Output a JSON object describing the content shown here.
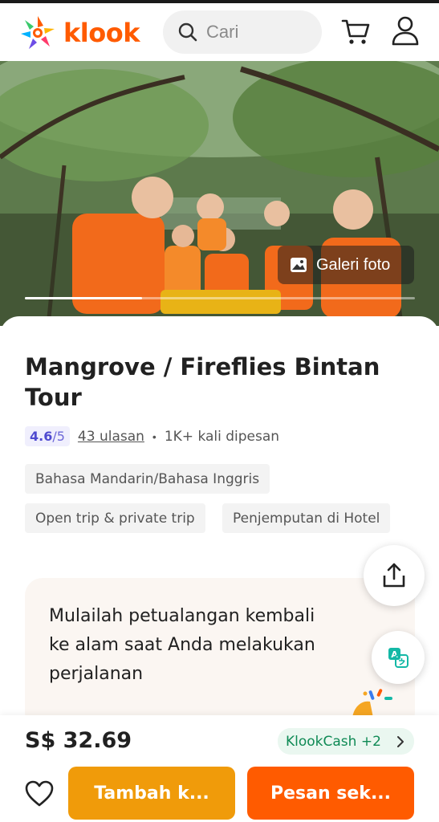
{
  "header": {
    "logo_text": "klook",
    "search_placeholder": "Cari",
    "icons": {
      "search": "search-icon",
      "cart": "cart-icon",
      "account": "user-icon"
    }
  },
  "hero": {
    "gallery_label": "Galeri foto",
    "gallery_icon": "image-icon",
    "carousel_progress": 0.3
  },
  "activity": {
    "title": "Mangrove / Fireflies Bintan Tour",
    "rating_score": "4.6",
    "rating_max": "/5",
    "reviews": "43 ulasan",
    "separator": "•",
    "booked": "1K+ kali dipesan",
    "tags": [
      "Bahasa Mandarin/Bahasa Inggris",
      "Open trip & private trip",
      "Penjemputan di Hotel"
    ]
  },
  "floating": {
    "share_icon": "share-icon",
    "translate_icon": "translate-icon"
  },
  "promo": {
    "text": "Mulailah petualangan kembali ke alam saat Anda melakukan perjalanan"
  },
  "footer": {
    "price": "S$ 32.69",
    "klookcash": "KlookCash +2",
    "add_to_cart": "Tambah k...",
    "book_now": "Pesan sek...",
    "wishlist_icon": "heart-icon"
  },
  "colors": {
    "brand": "#ff5b00",
    "cart_button": "#f09b0a",
    "rating_text": "#4f4ad0",
    "cash_text": "#0f8a55"
  }
}
